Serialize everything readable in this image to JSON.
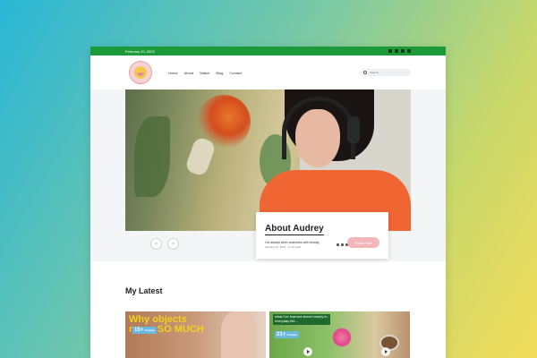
{
  "topbar": {
    "date": "February 20, 2023",
    "social_icons": [
      "instagram-icon",
      "youtube-icon",
      "tiktok-icon",
      "pinterest-icon"
    ],
    "color": "#1c9a3a"
  },
  "nav": {
    "items": [
      "Home",
      "About",
      "Watch",
      "Blog",
      "Contact"
    ],
    "search_placeholder": "Search..."
  },
  "hero": {
    "title": "About Audrey",
    "excerpt": "I've always been obsessed with beauty.",
    "meta": "January 24, 2021 · 1 min read",
    "button": "Read Post",
    "share_icons": [
      "pinterest-icon",
      "twitter-icon",
      "facebook-icon",
      "link-icon"
    ],
    "accent_color": "#f3b7b9"
  },
  "carousel": {
    "prev_icon": "‹",
    "next_icon": "›"
  },
  "latest": {
    "heading": "My Latest",
    "cards": [
      {
        "headline": "Why objects mean SO MUCH",
        "badge_number": "15+",
        "badge_label": "Youtube"
      },
      {
        "headline": "what I've learned about beauty in everyday life...",
        "badge_number": "21+",
        "badge_label": "Youtube"
      }
    ]
  }
}
